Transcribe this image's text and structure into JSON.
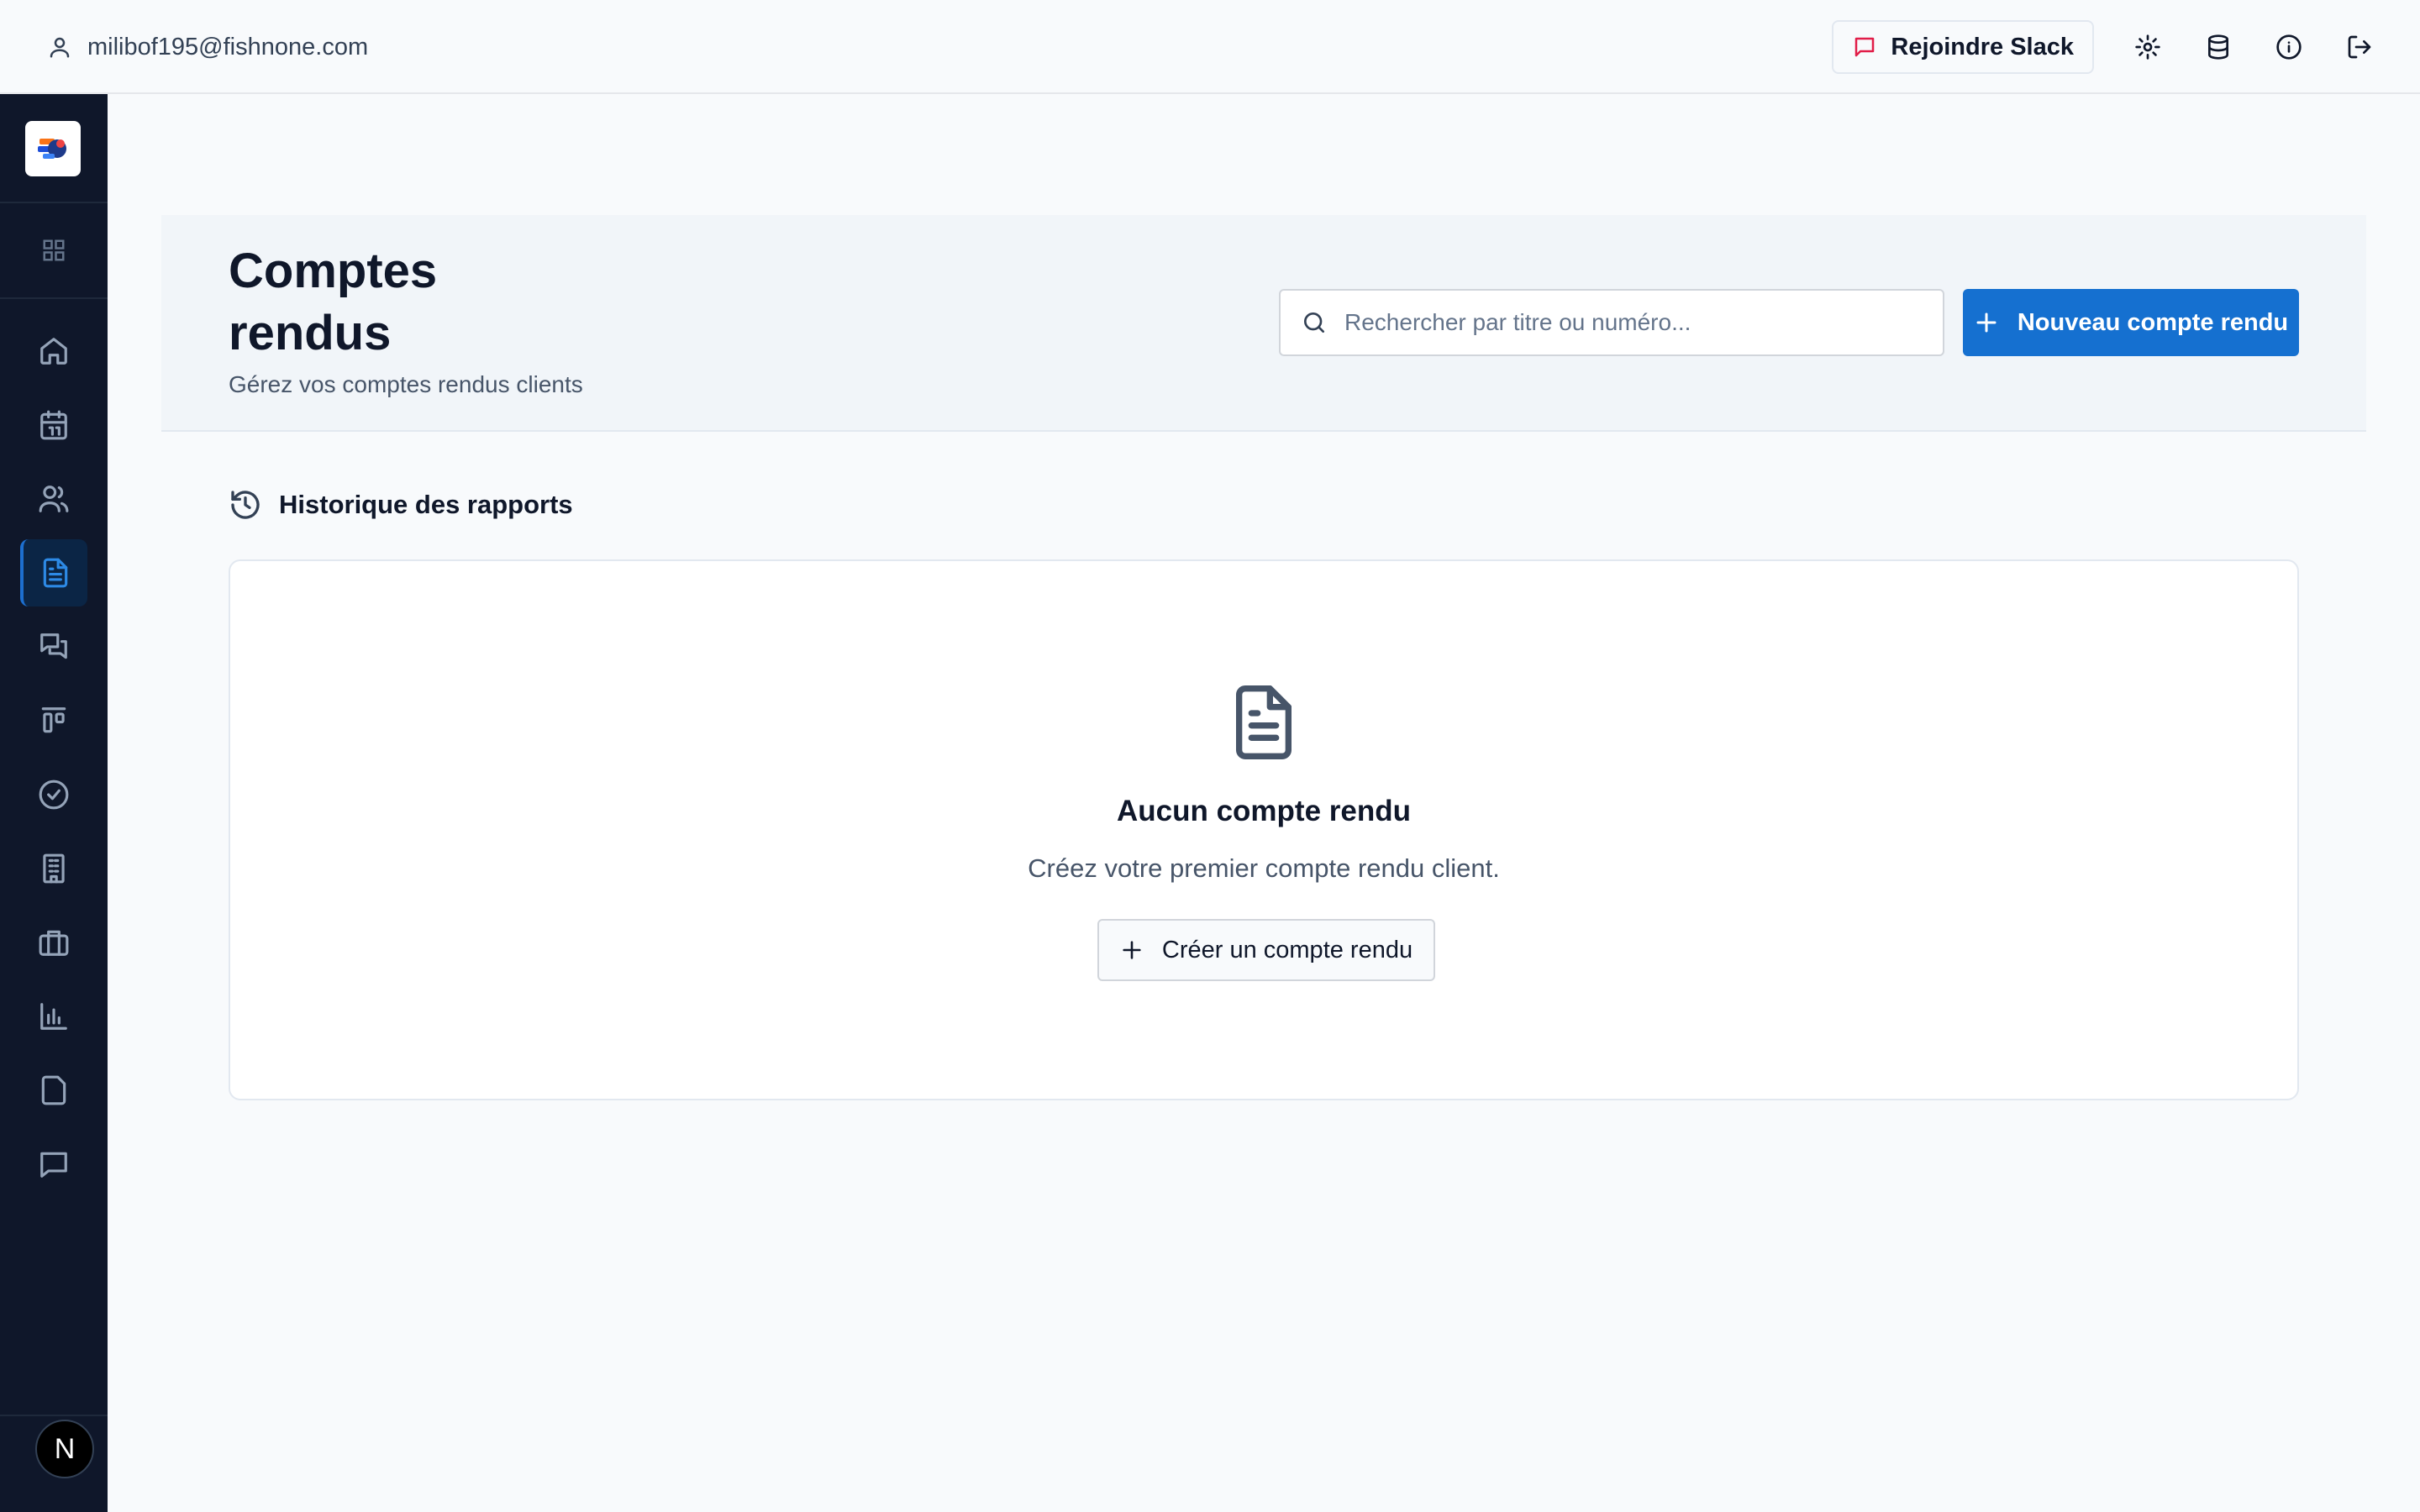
{
  "topbar": {
    "user_email": "milibof195@fishnone.com",
    "slack_label": "Rejoindre Slack",
    "icons": [
      "user-icon",
      "slack-message-icon",
      "settings-icon",
      "database-icon",
      "info-icon",
      "logout-icon"
    ]
  },
  "sidebar": {
    "items": [
      {
        "icon": "grid-icon"
      },
      {
        "icon": "home-icon"
      },
      {
        "icon": "calendar-icon"
      },
      {
        "icon": "users-icon"
      },
      {
        "icon": "file-text-icon",
        "active": true
      },
      {
        "icon": "messages-icon"
      },
      {
        "icon": "kanban-icon"
      },
      {
        "icon": "check-circle-icon"
      },
      {
        "icon": "building-icon"
      },
      {
        "icon": "briefcase-icon"
      },
      {
        "icon": "bar-chart-icon"
      },
      {
        "icon": "file-icon"
      },
      {
        "icon": "message-square-icon"
      }
    ],
    "avatar_letter": "N"
  },
  "header": {
    "title": "Comptes rendus",
    "subtitle": "Gérez vos comptes rendus clients",
    "search_placeholder": "Rechercher par titre ou numéro...",
    "new_button_label": "Nouveau compte rendu"
  },
  "history": {
    "title": "Historique des rapports",
    "empty_title": "Aucun compte rendu",
    "empty_text": "Créez votre premier compte rendu client.",
    "create_button_label": "Créer un compte rendu"
  },
  "colors": {
    "accent": "#1570d0",
    "sidebar_bg": "#0f172a",
    "page_bg": "#f8fafc"
  }
}
